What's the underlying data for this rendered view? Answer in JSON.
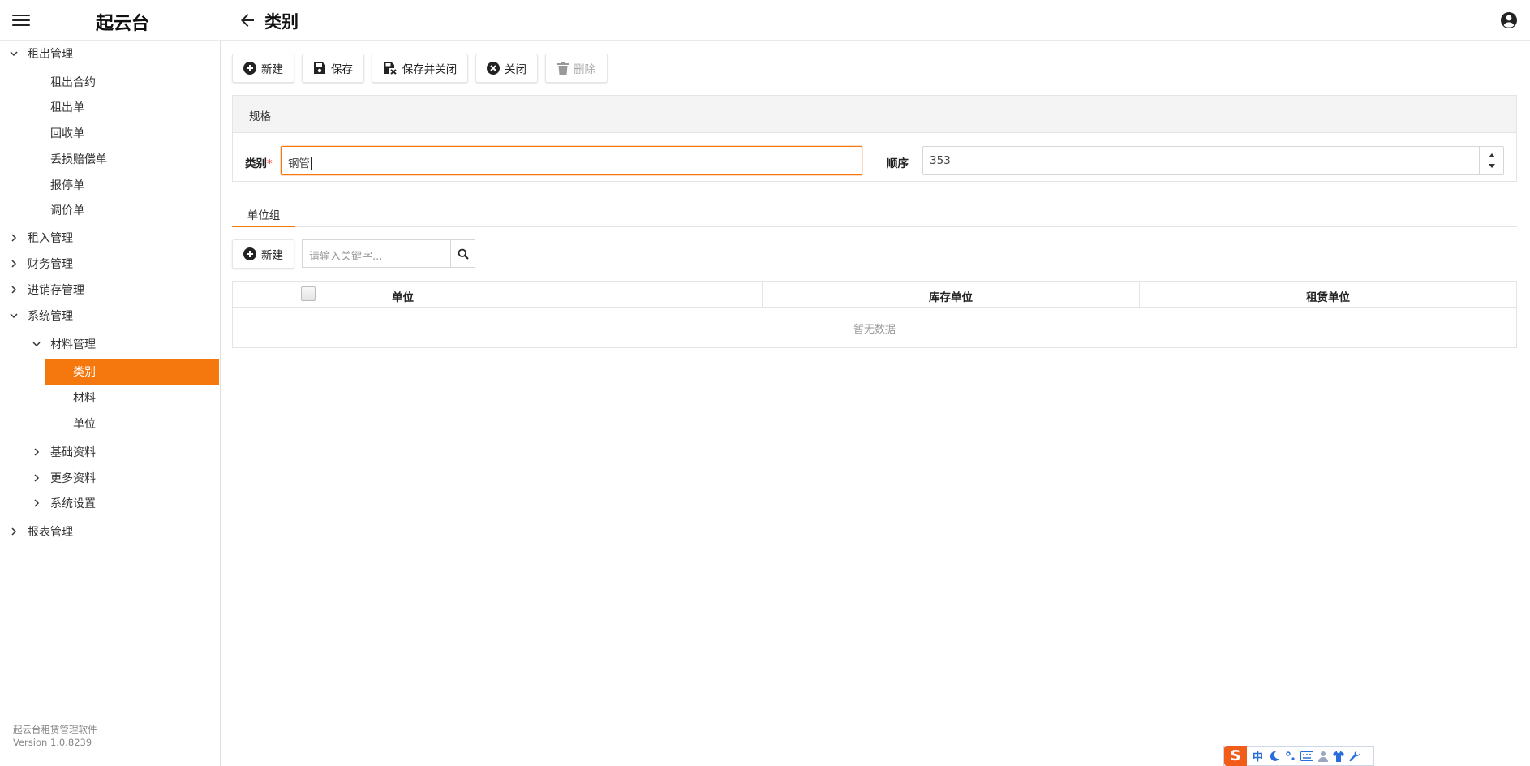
{
  "app": {
    "title": "起云台",
    "page_title": "类别"
  },
  "sidebar": {
    "groups": [
      {
        "label": "租出管理",
        "expanded": true,
        "items": [
          "租出合约",
          "租出单",
          "回收单",
          "丢损赔偿单",
          "报停单",
          "调价单"
        ]
      },
      {
        "label": "租入管理",
        "expanded": false
      },
      {
        "label": "财务管理",
        "expanded": false
      },
      {
        "label": "进销存管理",
        "expanded": false
      },
      {
        "label": "系统管理",
        "expanded": true,
        "sub": [
          {
            "label": "材料管理",
            "expanded": true,
            "items": [
              "类别",
              "材料",
              "单位"
            ],
            "active": "类别"
          },
          {
            "label": "基础资料",
            "expanded": false
          },
          {
            "label": "更多资料",
            "expanded": false
          },
          {
            "label": "系统设置",
            "expanded": false
          }
        ]
      },
      {
        "label": "报表管理",
        "expanded": false
      }
    ],
    "footer": {
      "line1": "起云台租赁管理软件",
      "line2": "Version 1.0.8239"
    }
  },
  "toolbar": {
    "new_label": "新建",
    "save_label": "保存",
    "save_close_label": "保存并关闭",
    "close_label": "关闭",
    "delete_label": "删除"
  },
  "form": {
    "section_title": "规格",
    "category_label": "类别",
    "category_required": "*",
    "category_value": "钢管",
    "order_label": "顺序",
    "order_value": "353"
  },
  "tabs": [
    {
      "label": "单位组",
      "active": true
    }
  ],
  "unit_group": {
    "new_label": "新建",
    "search_placeholder": "请输入关键字...",
    "columns": [
      "单位",
      "库存单位",
      "租赁单位"
    ],
    "empty_text": "暂无数据"
  },
  "ime": {
    "mode": "中"
  },
  "colors": {
    "accent": "#f5780f"
  }
}
